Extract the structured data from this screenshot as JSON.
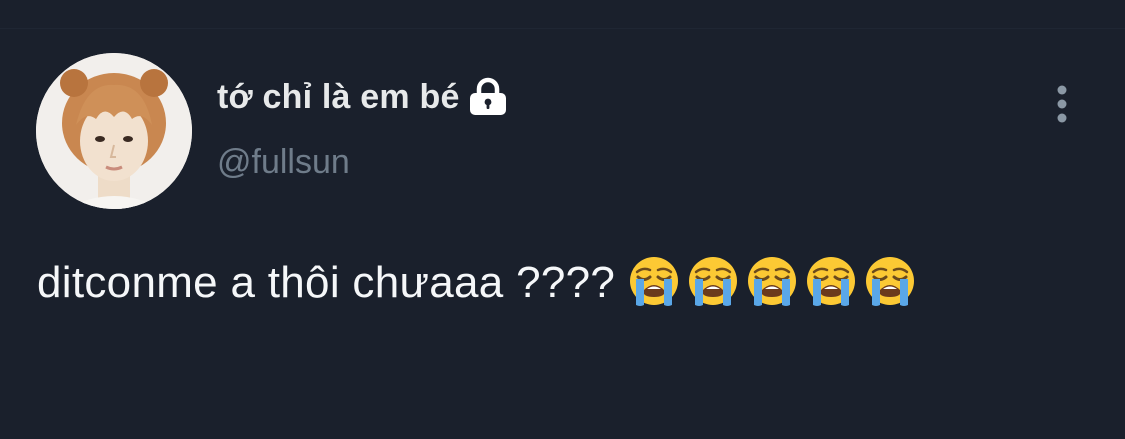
{
  "tweet": {
    "author": {
      "display_name": "tớ chỉ là em bé",
      "handle": "@fullsun",
      "protected_icon": "lock-icon",
      "avatar": "profile-photo"
    },
    "menu_icon": "more-vertical-icon",
    "text": "ditconme a thôi chưaaa ???? ",
    "emojis": [
      "loudly-crying-face",
      "loudly-crying-face",
      "loudly-crying-face",
      "loudly-crying-face",
      "loudly-crying-face"
    ]
  },
  "colors": {
    "background": "#1a202c",
    "text_primary": "#e7e9ea",
    "text_secondary": "#6f7c8a",
    "emoji_face": "#fcc934",
    "emoji_tear": "#5aa7e8"
  }
}
